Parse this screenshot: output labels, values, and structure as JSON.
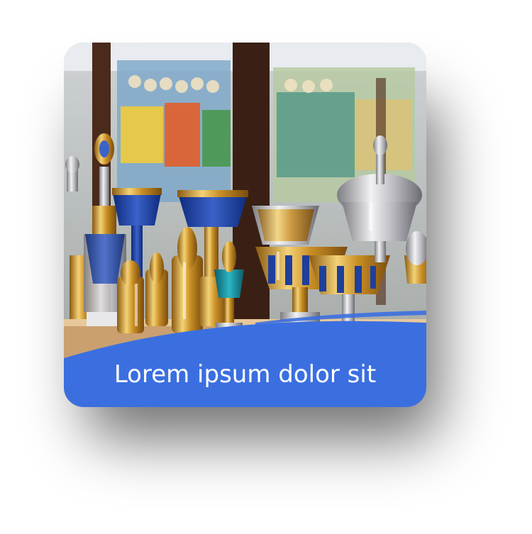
{
  "card": {
    "caption": "Lorem ipsum dolor sit",
    "photo_subject": "trophy-display-case",
    "colors": {
      "banner": "#3b6fe0",
      "caption_text": "#ffffff",
      "card_background": "#c9a35a"
    }
  }
}
